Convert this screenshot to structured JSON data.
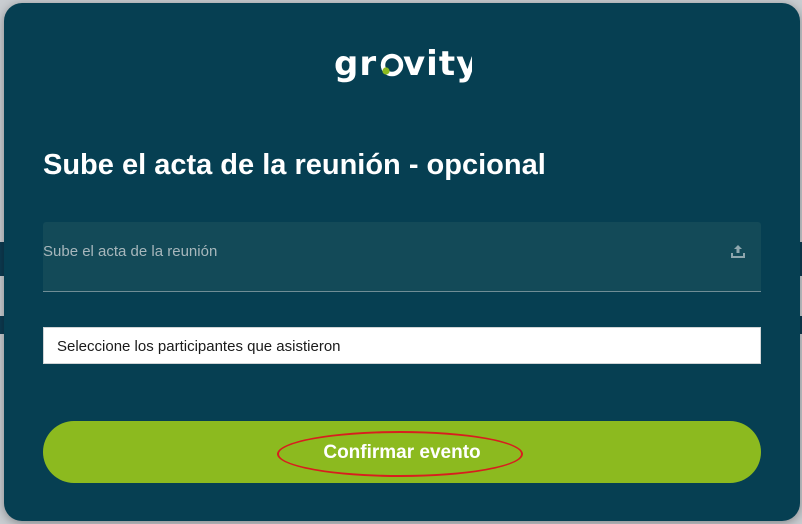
{
  "app": {
    "logo_text": "grovity"
  },
  "modal": {
    "title": "Sube el acta de la reunión - opcional",
    "upload": {
      "label": "Sube el acta de la reunión",
      "icon": "upload-icon"
    },
    "participants_select": {
      "value": "Seleccione los participantes que asistieron"
    },
    "confirm_button": {
      "label": "Confirmar evento"
    }
  },
  "colors": {
    "modal_bg": "#063f52",
    "field_bg": "#134a58",
    "accent_green": "#8cba1f",
    "logo_dot": "#8cba1f",
    "annotation_red": "#d81e1e"
  }
}
